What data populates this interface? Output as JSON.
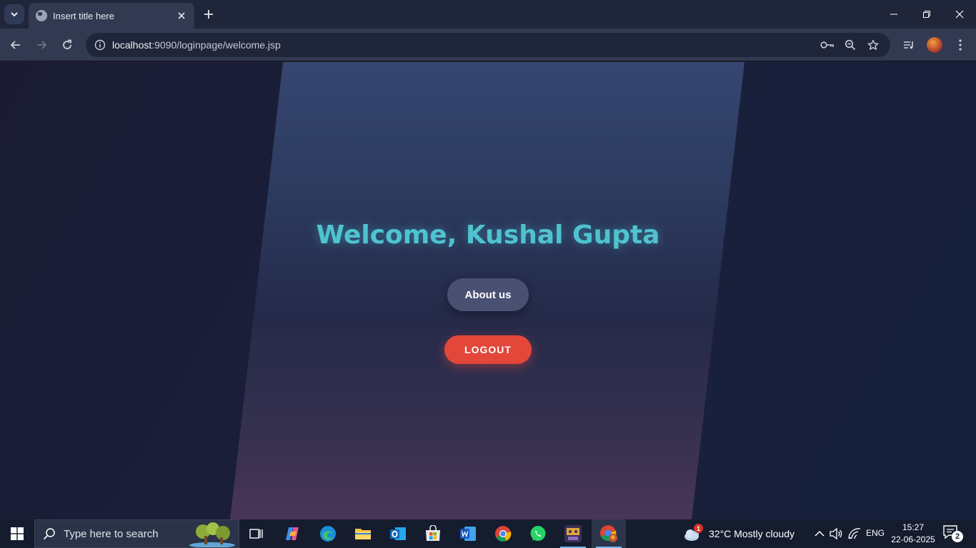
{
  "browser": {
    "tab_title": "Insert title here",
    "url_host": "localhost",
    "url_rest": ":9090/loginpage/welcome.jsp",
    "icons": [
      "tab-list-icon",
      "globe-icon",
      "close-icon",
      "plus-icon",
      "back-icon",
      "forward-icon",
      "reload-icon",
      "site-info-icon",
      "key-icon",
      "zoom-icon",
      "star-icon",
      "media-icon",
      "profile-icon",
      "menu-icon"
    ]
  },
  "page": {
    "welcome": "Welcome, Kushal Gupta",
    "about_label": "About us",
    "logout_label": "LOGOUT",
    "colors": {
      "welcome": "#4fc3cf",
      "about_button": "#4a5071",
      "logout_button": "#e2473a",
      "background": "#1a1f3a"
    }
  },
  "taskbar": {
    "search_placeholder": "Type here to search",
    "apps": [
      "task-view",
      "copilot",
      "edge",
      "file-explorer",
      "outlook",
      "microsoft-store",
      "word",
      "chrome",
      "whatsapp",
      "game",
      "chrome-profile"
    ],
    "weather_badge": "1",
    "weather": "32°C  Mostly cloudy",
    "language": "ENG",
    "time": "15:27",
    "date": "22-06-2025",
    "notification_count": "2"
  }
}
